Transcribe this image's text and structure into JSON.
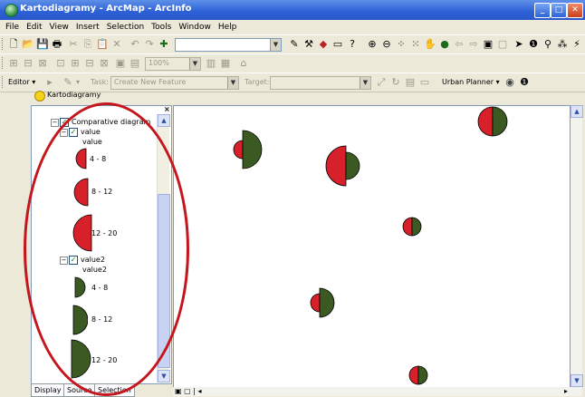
{
  "window": {
    "title": "Kartodiagramy - ArcMap - ArcInfo"
  },
  "menu": [
    "File",
    "Edit",
    "View",
    "Insert",
    "Selection",
    "Tools",
    "Window",
    "Help"
  ],
  "toolbar": {
    "zoom_value": "100%",
    "editor_label": "Editor",
    "task_label": "Task:",
    "task_value": "Create New Feature",
    "target_label": "Target:",
    "urban_planner_label": "Urban Planner"
  },
  "kartodiagramy_button": "Kartodiagramy",
  "toc": {
    "layer_name": "Comparative diagram",
    "groups": [
      {
        "name": "value",
        "field": "value",
        "classes": [
          "4 - 8",
          "8 - 12",
          "12 - 20"
        ],
        "color": "#d8202a"
      },
      {
        "name": "value2",
        "field": "value2",
        "classes": [
          "4 - 8",
          "8 - 12",
          "12 - 20"
        ],
        "color": "#3a5a22"
      }
    ]
  },
  "tabs": [
    "Display",
    "Source",
    "Selection"
  ],
  "colors": {
    "red": "#d8202a",
    "green": "#3a5a22",
    "highlight": "#c4161c"
  }
}
